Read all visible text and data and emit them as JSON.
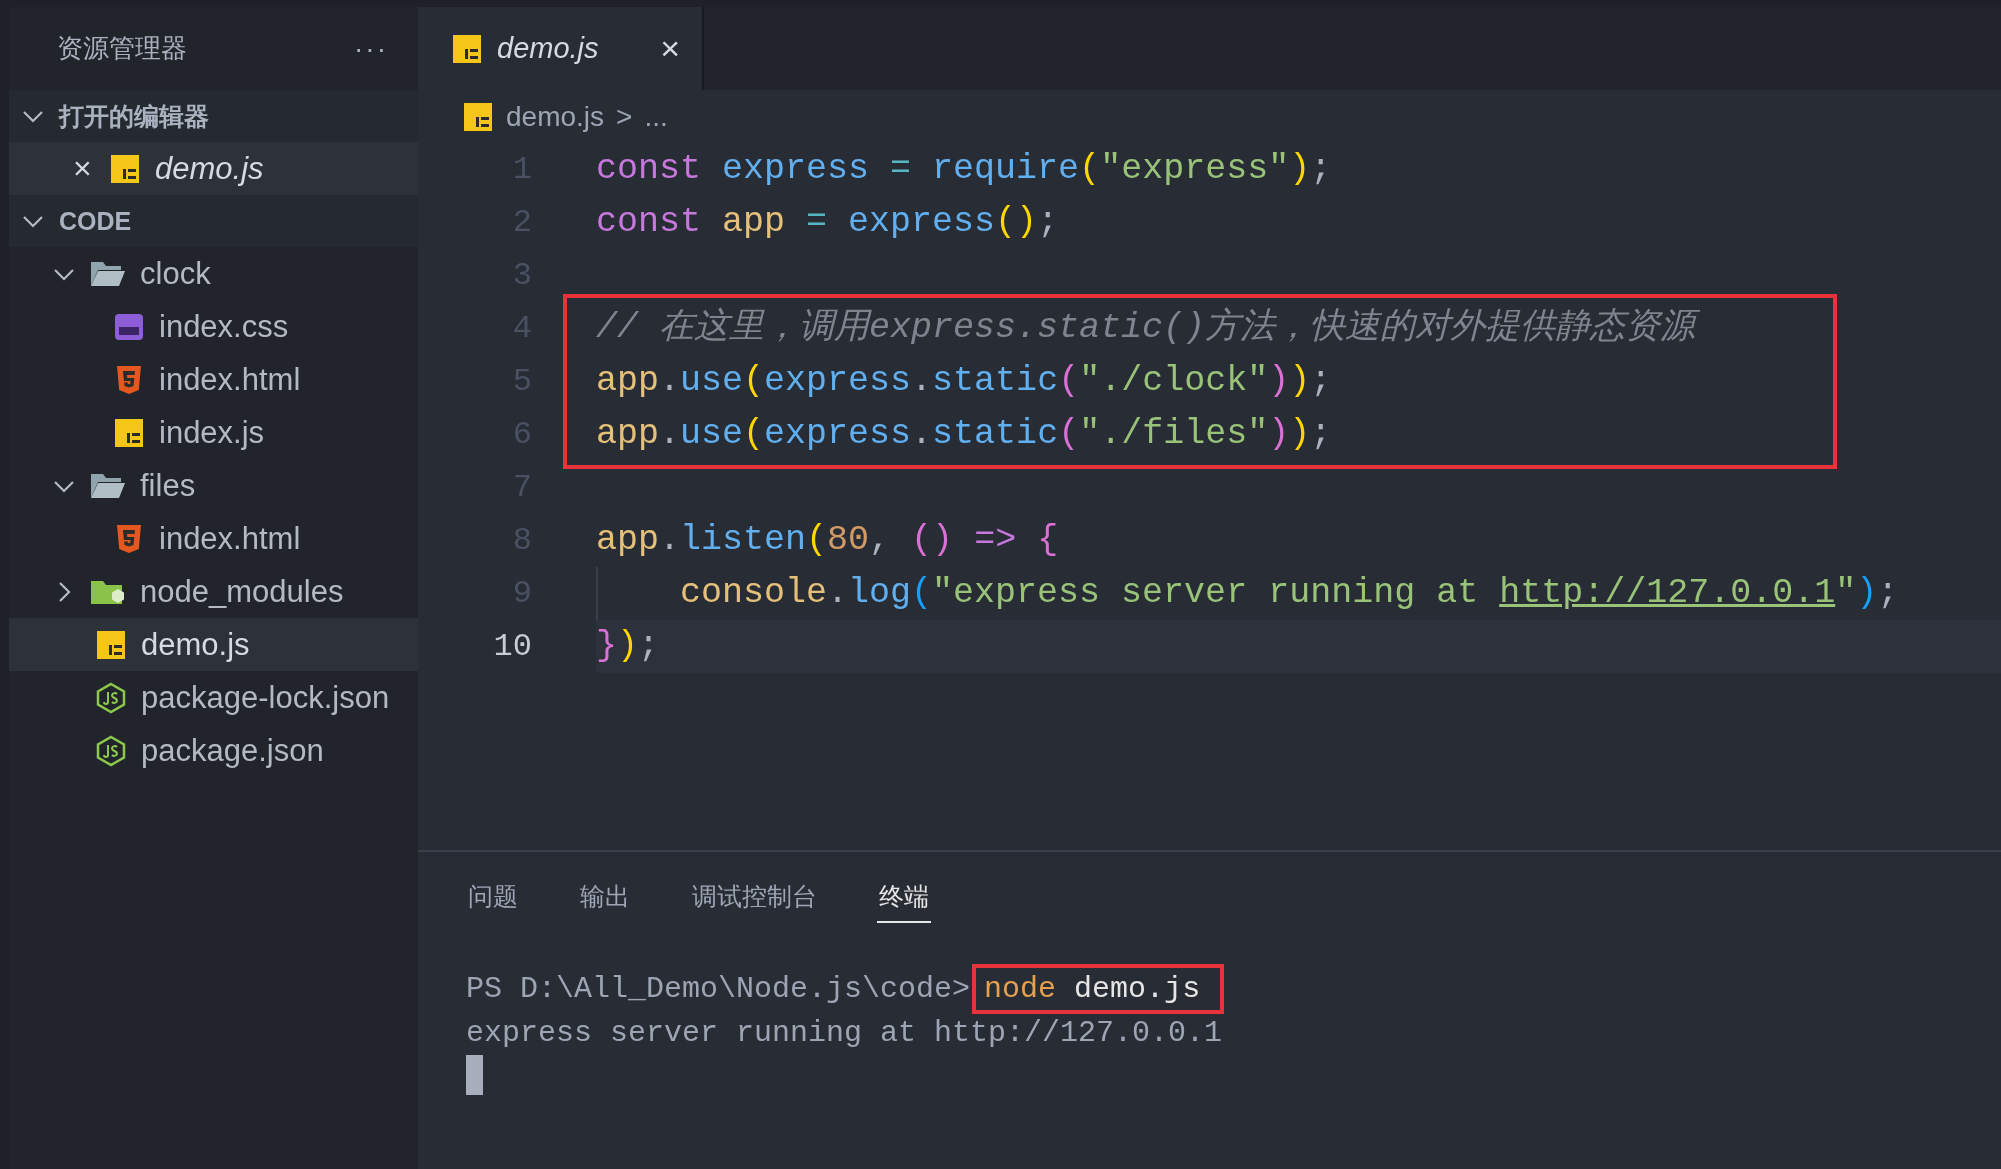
{
  "sidebar": {
    "title": "资源管理器",
    "more": "···",
    "open_editors": {
      "label": "打开的编辑器",
      "expanded": true,
      "items": [
        {
          "name": "demo.js",
          "kind": "js",
          "close": "×",
          "selected": true
        }
      ]
    },
    "workspace": {
      "label": "CODE",
      "expanded": true,
      "items": [
        {
          "name": "clock",
          "kind": "folder",
          "expanded": true,
          "selected": false,
          "children": [
            {
              "name": "index.css",
              "kind": "css",
              "selected": false
            },
            {
              "name": "index.html",
              "kind": "html",
              "selected": false
            },
            {
              "name": "index.js",
              "kind": "js",
              "selected": false
            }
          ]
        },
        {
          "name": "files",
          "kind": "folder",
          "expanded": true,
          "selected": false,
          "children": [
            {
              "name": "index.html",
              "kind": "html",
              "selected": false
            }
          ]
        },
        {
          "name": "node_modules",
          "kind": "node_folder",
          "expanded": false,
          "selected": false
        },
        {
          "name": "demo.js",
          "kind": "js",
          "selected": true
        },
        {
          "name": "package-lock.json",
          "kind": "json",
          "selected": false
        },
        {
          "name": "package.json",
          "kind": "json",
          "selected": false
        }
      ]
    }
  },
  "tabs": [
    {
      "label": "demo.js",
      "kind": "js",
      "close": "×",
      "selected": true
    }
  ],
  "breadcrumb": {
    "file": "demo.js",
    "kind": "js",
    "separator": ">",
    "rest": "..."
  },
  "code": [
    {
      "number": "1",
      "boxed": false,
      "current": false,
      "indented": false,
      "tokens": [
        {
          "t": "const ",
          "kind": "keyword"
        },
        {
          "t": "express",
          "kind": "function"
        },
        {
          "t": " = ",
          "kind": "operator"
        },
        {
          "t": "require",
          "kind": "function"
        },
        {
          "t": "(",
          "kind": "paren1"
        },
        {
          "t": "\"express\"",
          "kind": "string"
        },
        {
          "t": ")",
          "kind": "paren1"
        },
        {
          "t": ";",
          "kind": "punct"
        }
      ]
    },
    {
      "number": "2",
      "boxed": false,
      "current": false,
      "indented": false,
      "tokens": [
        {
          "t": "const ",
          "kind": "keyword"
        },
        {
          "t": "app",
          "kind": "variable"
        },
        {
          "t": " = ",
          "kind": "operator"
        },
        {
          "t": "express",
          "kind": "function"
        },
        {
          "t": "(",
          "kind": "paren1"
        },
        {
          "t": ")",
          "kind": "paren1"
        },
        {
          "t": ";",
          "kind": "punct"
        }
      ]
    },
    {
      "number": "3",
      "boxed": false,
      "current": false,
      "indented": false
    },
    {
      "number": "4",
      "boxed": true,
      "current": false,
      "indented": false,
      "tokens": [
        {
          "t": "// 在这里，调用express.static()方法，快速的对外提供静态资源",
          "kind": "comment"
        }
      ]
    },
    {
      "number": "5",
      "boxed": true,
      "current": false,
      "indented": false,
      "tokens": [
        {
          "t": "app",
          "kind": "variable"
        },
        {
          "t": ".",
          "kind": "punct"
        },
        {
          "t": "use",
          "kind": "function"
        },
        {
          "t": "(",
          "kind": "paren1"
        },
        {
          "t": "express",
          "kind": "function"
        },
        {
          "t": ".",
          "kind": "punct"
        },
        {
          "t": "static",
          "kind": "function"
        },
        {
          "t": "(",
          "kind": "paren2"
        },
        {
          "t": "\"./clock\"",
          "kind": "string"
        },
        {
          "t": ")",
          "kind": "paren2"
        },
        {
          "t": ")",
          "kind": "paren1"
        },
        {
          "t": ";",
          "kind": "punct"
        }
      ]
    },
    {
      "number": "6",
      "boxed": true,
      "current": false,
      "indented": false,
      "tokens": [
        {
          "t": "app",
          "kind": "variable"
        },
        {
          "t": ".",
          "kind": "punct"
        },
        {
          "t": "use",
          "kind": "function"
        },
        {
          "t": "(",
          "kind": "paren1"
        },
        {
          "t": "express",
          "kind": "function"
        },
        {
          "t": ".",
          "kind": "punct"
        },
        {
          "t": "static",
          "kind": "function"
        },
        {
          "t": "(",
          "kind": "paren2"
        },
        {
          "t": "\"./files\"",
          "kind": "string"
        },
        {
          "t": ")",
          "kind": "paren2"
        },
        {
          "t": ")",
          "kind": "paren1"
        },
        {
          "t": ";",
          "kind": "punct"
        }
      ]
    },
    {
      "number": "7",
      "boxed": false,
      "current": false,
      "indented": false
    },
    {
      "number": "8",
      "boxed": false,
      "current": false,
      "indented": false,
      "tokens": [
        {
          "t": "app",
          "kind": "variable"
        },
        {
          "t": ".",
          "kind": "punct"
        },
        {
          "t": "listen",
          "kind": "function"
        },
        {
          "t": "(",
          "kind": "paren1"
        },
        {
          "t": "80",
          "kind": "number"
        },
        {
          "t": ", ",
          "kind": "punct"
        },
        {
          "t": "()",
          "kind": "paren2"
        },
        {
          "t": " => ",
          "kind": "keyword"
        },
        {
          "t": "{",
          "kind": "paren2"
        }
      ]
    },
    {
      "number": "9",
      "boxed": false,
      "current": false,
      "indented": true,
      "tokens": [
        {
          "t": "console",
          "kind": "variable"
        },
        {
          "t": ".",
          "kind": "punct"
        },
        {
          "t": "log",
          "kind": "function"
        },
        {
          "t": "(",
          "kind": "paren3"
        },
        {
          "t": "\"express server running at ",
          "kind": "string"
        },
        {
          "t": "http://127.0.0.1",
          "kind": "link"
        },
        {
          "t": "\"",
          "kind": "string"
        },
        {
          "t": ")",
          "kind": "paren3"
        },
        {
          "t": ";",
          "kind": "punct"
        }
      ]
    },
    {
      "number": "10",
      "boxed": false,
      "current": true,
      "indented": false,
      "tokens": [
        {
          "t": "}",
          "kind": "paren2"
        },
        {
          "t": ")",
          "kind": "paren1"
        },
        {
          "t": ";",
          "kind": "punct"
        }
      ]
    }
  ],
  "panel": {
    "tabs": [
      {
        "label": "问题",
        "selected": false
      },
      {
        "label": "输出",
        "selected": false
      },
      {
        "label": "调试控制台",
        "selected": false
      },
      {
        "label": "终端",
        "selected": true
      }
    ],
    "terminal": [
      {
        "kind": "command",
        "prompt": "PS D:\\All_Demo\\Node.js\\code>",
        "program": "node",
        "argument": "demo.js",
        "boxed": true
      },
      {
        "kind": "output",
        "text": "express server running at http://127.0.0.1"
      }
    ]
  }
}
